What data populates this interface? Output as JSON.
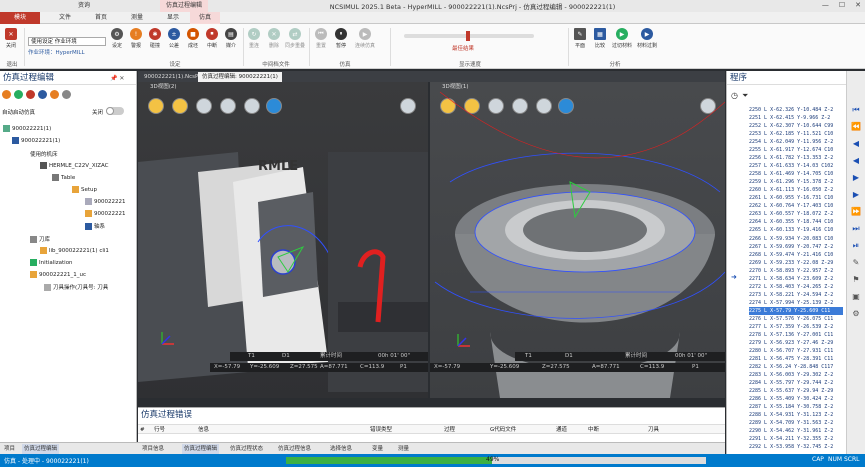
{
  "title": "NCSIMUL 2025.1 Beta - HyperMILL - 900022221(1).NcsPrj - 仿真过程编辑 - 900022221(1)",
  "window_controls": [
    "—",
    "☐",
    "✕"
  ],
  "context_tabs": {
    "left": "资询",
    "right": "仿真过程编辑"
  },
  "tabs": [
    "模块",
    "文件",
    "首页",
    "测量",
    "显示",
    "仿真"
  ],
  "ribbon": {
    "close": "关闭",
    "exit_group": "退出",
    "env_select": "使用设定 作业环境",
    "env_label": "作业环境：HyperMILL",
    "settings_group": "设定",
    "tools": [
      "设定",
      "警报",
      "碰撞",
      "公差",
      "成坯",
      "中断",
      "媒介"
    ],
    "midfile_btns": [
      "重连",
      "删除",
      "同步重叠"
    ],
    "midfile_group": "中间档文件",
    "sim_btns": [
      "重置",
      "暂停",
      "连续仿真"
    ],
    "sim_group": "仿真",
    "speed_label": "最佳结果",
    "speed_group": "显示速度",
    "analysis_btns": [
      "平面",
      "比较",
      "过切材料",
      "材料过剩"
    ],
    "analysis_group": "分析"
  },
  "left_panel": {
    "title": "仿真过程编辑",
    "auto_label": "自动启动仿真",
    "toggle": "关闭",
    "tree": [
      {
        "label": "900022221(1)",
        "level": 0
      },
      {
        "label": "900022221(1)",
        "level": 1
      },
      {
        "label": "使用的机床",
        "level": 2
      },
      {
        "label": "HERMLE_C22V_XIZAC",
        "level": 3
      },
      {
        "label": "Table",
        "level": 4
      },
      {
        "label": "Setup",
        "level": 5
      },
      {
        "label": "900022221",
        "level": 6
      },
      {
        "label": "900022221",
        "level": 6
      },
      {
        "label": "轴系",
        "level": 6
      },
      {
        "label": "刀库",
        "level": 2
      },
      {
        "label": "lib_900022221(1) cli1",
        "level": 3
      },
      {
        "label": "Initialization",
        "level": 2
      },
      {
        "label": "900022221_1_uc",
        "level": 2
      },
      {
        "label": "刀具操作(刀具号: 刀具",
        "level": 3
      }
    ]
  },
  "doc_tabs": [
    "900022221(1).NcsPrj",
    "仿真过程编辑: 900022221(1)"
  ],
  "view1": {
    "header": "3D视图(2)",
    "status": {
      "t": "T1",
      "d": "D1",
      "time": "累计时间",
      "clock": "00h 01' 00\"",
      "x": "X=-57.79",
      "y": "Y=-25.609",
      "z": "Z=27.575",
      "a": "A=87.771",
      "c": "C=113.9",
      "p": "P1"
    }
  },
  "view2": {
    "header": "3D视图(1)",
    "status": {
      "t": "T1",
      "d": "D1",
      "time": "累计时间",
      "clock": "00h 01' 00\"",
      "x": "X=-57.79",
      "y": "Y=-25.609",
      "z": "Z=27.575",
      "a": "A=87.771",
      "c": "C=113.9",
      "p": "P1"
    }
  },
  "errors": {
    "title": "仿真过程错误",
    "columns": [
      "#",
      "行号",
      "信息",
      "错误类型",
      "过程",
      "G代码文件",
      "通道",
      "中断",
      "刀具"
    ]
  },
  "bottom_tabs": [
    "项目信息",
    "仿真过程编辑",
    "仿真过程状态",
    "仿真过程信息",
    "选择信息",
    "变量",
    "测量"
  ],
  "left_bottom_tabs": [
    "项目",
    "仿真过程编辑"
  ],
  "status": {
    "left": "仿真 - 处理中 - 900022221(1)",
    "progress": "49%",
    "progress_value": 0.49,
    "right": [
      "CAP",
      "NUM",
      "SCRL"
    ]
  },
  "program": {
    "title": "程序",
    "lines": [
      "2250 L X-62.326 Y-10.484 Z-2",
      "2251 L X-62.415 Y-9.966 Z-2",
      "2252 L X-62.307 Y-10.644 C99",
      "2253 L X-62.185 Y-11.521 C10",
      "2254 L X-62.049 Y-11.956 Z-2",
      "2255 L X-61.917 Y-12.674 C10",
      "2256 L X-61.782 Y-13.353 Z-2",
      "2257 L X-61.633 Y-14.03 C102",
      "2258 L X-61.469 Y-14.705 C10",
      "2259 L X-61.296 Y-15.378 Z-2",
      "2260 L X-61.113 Y-16.050 Z-2",
      "2261 L X-60.955 Y-16.731 C10",
      "2262 L X-60.764 Y-17.403 C10",
      "2263 L X-60.557 Y-18.072 Z-2",
      "2264 L X-60.355 Y-18.744 C10",
      "2265 L X-60.133 Y-19.416 C10",
      "2266 L X-59.934 Y-20.083 C10",
      "2267 L X-59.699 Y-20.747 Z-2",
      "2268 L X-59.474 Y-21.416 C10",
      "2269 L X-59.233 Y-22.08 Z-29",
      "2270 L X-58.893 Y-22.957 Z-2",
      "2271 L X-58.634 Y-23.609 Z-2",
      "2272 L X-58.403 Y-24.265 Z-2",
      "2273 L X-58.221 Y-24.594 Z-2",
      "2274 L X-57.994 Y-25.139 Z-2",
      "2275 L X-57.79 Y-25.609 C11",
      "2276 L X-57.576 Y-26.075 C11",
      "2277 L X-57.359 Y-26.539 Z-2",
      "2278 L X-57.136 Y-27.001 C11",
      "2279 L X-56.923 Y-27.46 Z-29",
      "2280 L X-56.707 Y-27.931 C11",
      "2281 L X-56.475 Y-28.391 C11",
      "2282 L X-56.24 Y-28.848 C117",
      "2283 L X-56.003 Y-29.302 Z-2",
      "2284 L X-55.797 Y-29.744 Z-2",
      "2285 L X-55.637 Y-29.94 Z-29",
      "2286 L X-55.409 Y-30.424 Z-2",
      "2287 L X-55.184 Y-30.758 Z-2",
      "2288 L X-54.931 Y-31.123 Z-2",
      "2289 L X-54.709 Y-31.563 Z-2",
      "2290 L X-54.462 Y-31.961 Z-2",
      "2291 L X-54.211 Y-32.355 Z-2",
      "2292 L X-53.958 Y-32.745 Z-2",
      "2293 L X-53.682 Y-32.913 Z-2"
    ],
    "highlight_index": 25
  }
}
